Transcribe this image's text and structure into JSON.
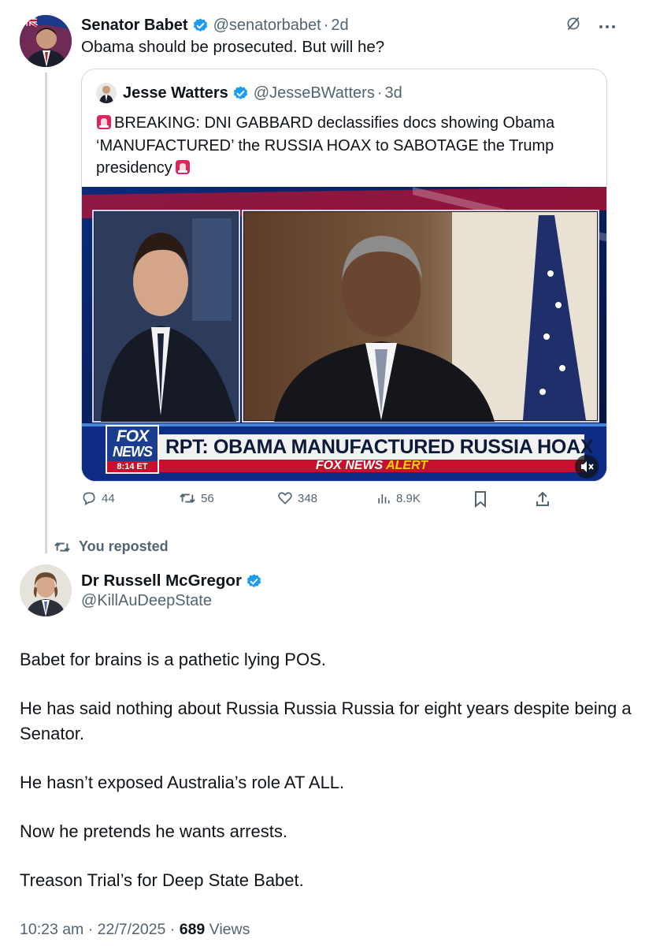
{
  "tweet1": {
    "name": "Senator Babet",
    "handle": "@senatorbabet",
    "time": "2d",
    "text": "Obama should be prosecuted. But will he?",
    "quote": {
      "name": "Jesse Watters",
      "handle": "@JesseBWatters",
      "time": "3d",
      "text_main": "BREAKING: DNI GABBARD declassifies docs showing Obama ‘MANUFACTURED’ the RUSSIA HOAX to SABOTAGE the Trump presidency",
      "video": {
        "logo_line1": "FOX",
        "logo_line2": "NEWS",
        "logo_time": "8:14 ET",
        "chyron": "RPT: OBAMA MANUFACTURED RUSSIA HOAX",
        "alert_brand": "FOX NEWS",
        "alert_word": "ALERT"
      }
    },
    "actions": {
      "replies": "44",
      "reposts": "56",
      "likes": "348",
      "views": "8.9K"
    }
  },
  "repost_label": "You reposted",
  "tweet2": {
    "name": "Dr Russell McGregor",
    "handle": "@KillAuDeepState",
    "paragraphs": [
      "Babet for brains is a pathetic lying POS.",
      "He has said nothing about Russia Russia Russia for eight years despite being a Senator.",
      "He hasn’t exposed Australia’s role AT ALL.",
      "Now he pretends he wants arrests.",
      "Treason Trial’s for Deep State Babet."
    ],
    "timestamp": "10:23 am · 22/7/2025 · ",
    "views_count": "689",
    "views_label": " Views"
  },
  "colors": {
    "text": "#0f1419",
    "muted": "#536471",
    "verified": "#1d9bf0",
    "border": "#cfd9de"
  }
}
